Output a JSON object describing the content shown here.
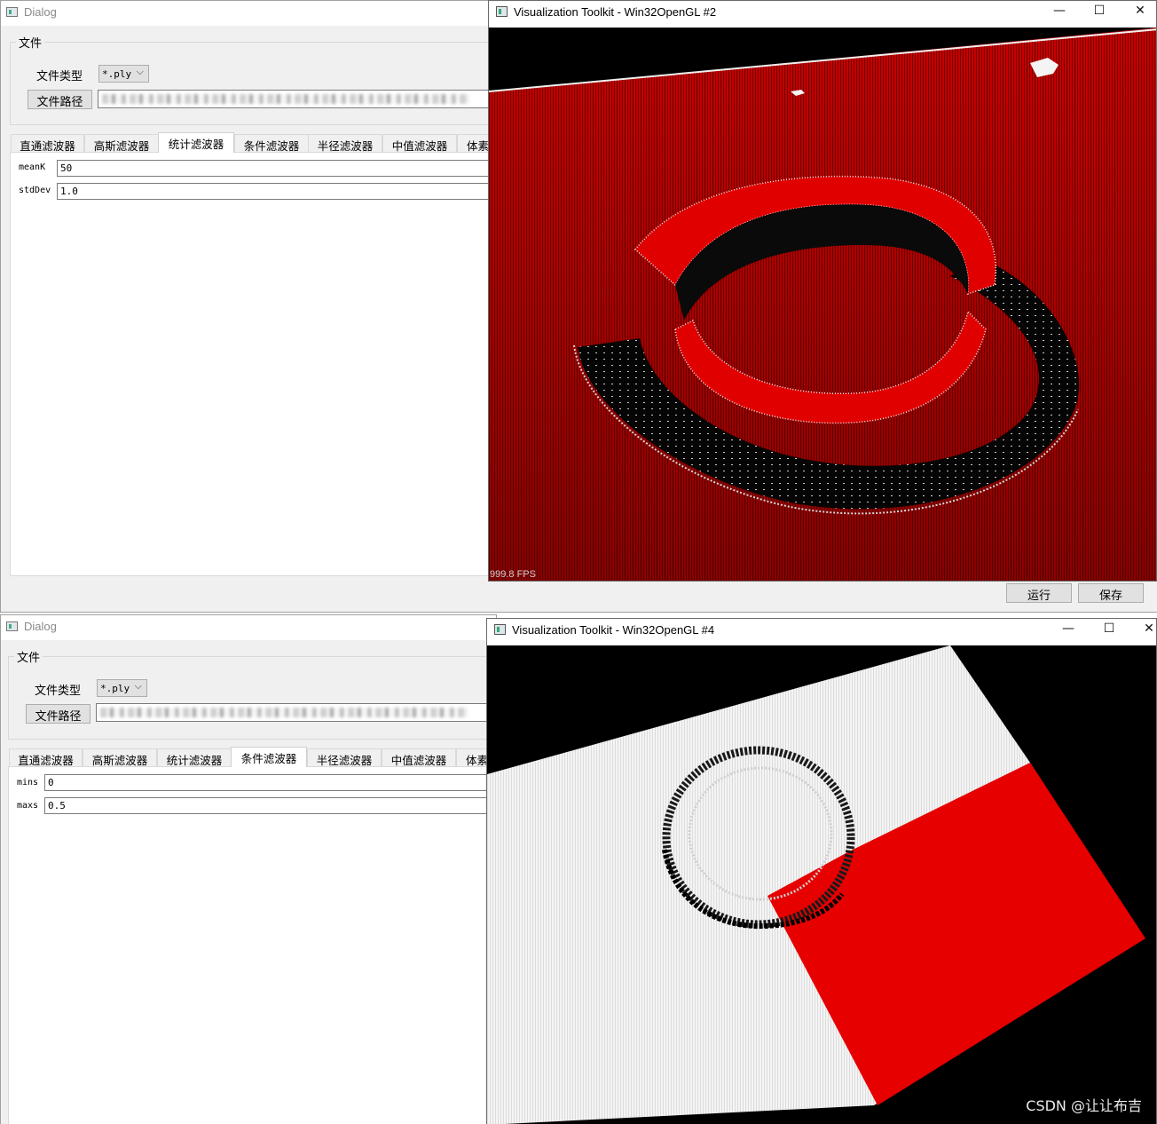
{
  "top": {
    "dialog_title": "Dialog",
    "group_title": "文件",
    "filetype_label": "文件类型",
    "filetype_value": "*.ply",
    "filepath_button": "文件路径",
    "tabs": [
      "直通滤波器",
      "高斯滤波器",
      "统计滤波器",
      "条件滤波器",
      "半径滤波器",
      "中值滤波器",
      "体素"
    ],
    "selected_tab": "统计滤波器",
    "fields": [
      {
        "label": "meanK",
        "value": "50"
      },
      {
        "label": "stdDev",
        "value": "1.0"
      }
    ],
    "run_button": "运行",
    "save_button": "保存",
    "vtk_title": "Visualization Toolkit - Win32OpenGL #2",
    "fps": "999.8 FPS"
  },
  "bottom": {
    "dialog_title": "Dialog",
    "group_title": "文件",
    "filetype_label": "文件类型",
    "filetype_value": "*.ply",
    "filepath_button": "文件路径",
    "tabs": [
      "直通滤波器",
      "高斯滤波器",
      "统计滤波器",
      "条件滤波器",
      "半径滤波器",
      "中值滤波器",
      "体素"
    ],
    "selected_tab": "条件滤波器",
    "fields": [
      {
        "label": "mins",
        "value": "0"
      },
      {
        "label": "maxs",
        "value": "0.5"
      }
    ],
    "vtk_title": "Visualization Toolkit - Win32OpenGL #4"
  },
  "window_controls": {
    "minimize": "—",
    "maximize": "☐",
    "close": "✕"
  },
  "watermark": "CSDN @让让布吉",
  "colors": {
    "point_cloud_red": "#e00000",
    "viewport_bg": "#000000",
    "cloud_white": "#f2f2f2"
  }
}
